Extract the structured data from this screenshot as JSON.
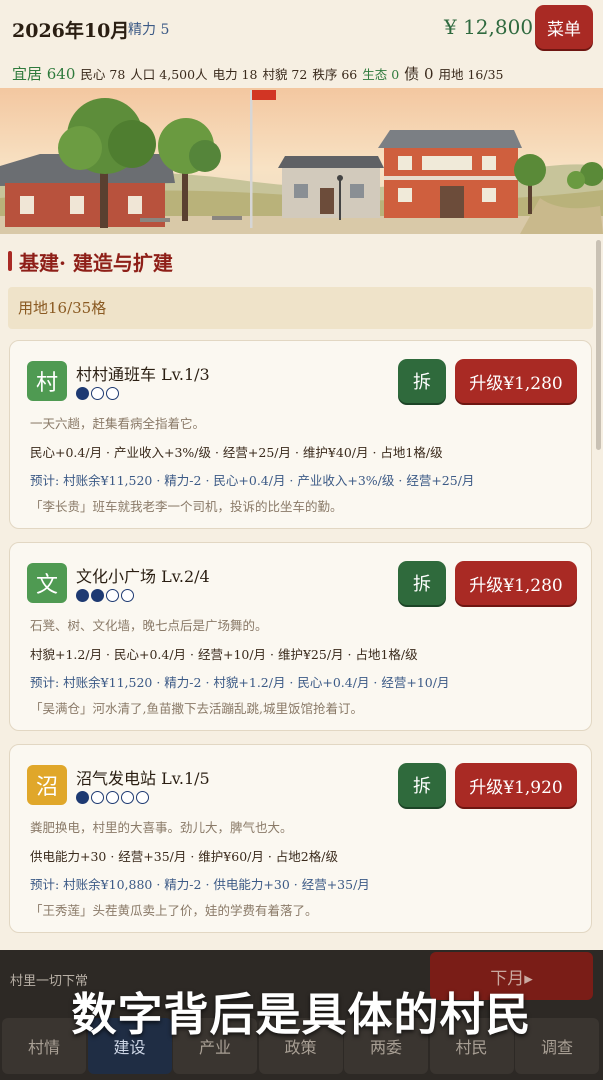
{
  "header": {
    "date": "2026年10月",
    "energy": "精力 5",
    "money": "¥ 12,800",
    "menu_label": "菜单"
  },
  "stats": [
    {
      "label": "宜居 640",
      "style": "green big"
    },
    {
      "label": "民心 78",
      "style": ""
    },
    {
      "label": "人口 4,500人",
      "style": ""
    },
    {
      "label": "电力 18",
      "style": ""
    },
    {
      "label": "村貌 72",
      "style": ""
    },
    {
      "label": "秩序 66",
      "style": ""
    },
    {
      "label": "生态 0",
      "style": "green"
    },
    {
      "label": "债 0",
      "style": "big"
    },
    {
      "label": "用地 16/35",
      "style": ""
    }
  ],
  "section": {
    "title": "基建· 建造与扩建",
    "land": "用地16/35格"
  },
  "cards": [
    {
      "icon_char": "村",
      "icon_color": "#4f9a52",
      "name": "村村通班车 Lv.1/3",
      "level": 1,
      "max_level": 3,
      "demolish": "拆",
      "upgrade": "升级¥1,280",
      "desc": "一天六趟，赶集看病全指着它。",
      "effects": "民心+0.4/月 · 产业收入+3%/级 · 经营+25/月 · 维护¥40/月 · 占地1格/级",
      "preview": "预计:  村账余¥11,520 · 精力-2 · 民心+0.4/月 · 产业收入+3%/级 · 经营+25/月",
      "quote": "「李长贵」班车就我老李一个司机，投诉的比坐车的勤。"
    },
    {
      "icon_char": "文",
      "icon_color": "#4f9a52",
      "name": "文化小广场 Lv.2/4",
      "level": 2,
      "max_level": 4,
      "demolish": "拆",
      "upgrade": "升级¥1,280",
      "desc": "石凳、树、文化墙，晚七点后是广场舞的。",
      "effects": "村貌+1.2/月 · 民心+0.4/月 · 经营+10/月 · 维护¥25/月 · 占地1格/级",
      "preview": "预计:  村账余¥11,520 · 精力-2 · 村貌+1.2/月 · 民心+0.4/月 · 经营+10/月",
      "quote": "「吴满仓」河水清了,鱼苗撒下去活蹦乱跳,城里饭馆抢着订。"
    },
    {
      "icon_char": "沼",
      "icon_color": "#e0a72a",
      "name": "沼气发电站 Lv.1/5",
      "level": 1,
      "max_level": 5,
      "demolish": "拆",
      "upgrade": "升级¥1,920",
      "desc": "粪肥换电，村里的大喜事。劲儿大，脾气也大。",
      "effects": "供电能力+30 ·     经营+35/月 · 维护¥60/月 · 占地2格/级",
      "preview": "预计:  村账余¥10,880 · 精力-2 · 供电能力+30 ·     经营+35/月",
      "quote": "「王秀莲」头茬黄瓜卖上了价，娃的学费有着落了。"
    }
  ],
  "bottom": {
    "status": "村里一切下常",
    "next_month": "下月▸",
    "caption": "数字背后是具体的村民",
    "tabs": [
      "村情",
      "建设",
      "产业",
      "政策",
      "两委",
      "村民",
      "调查"
    ],
    "active_tab": "建设"
  },
  "colors": {
    "accent_red": "#a92a24",
    "accent_green": "#2f6a3c",
    "accent_blue": "#3c5a86"
  }
}
